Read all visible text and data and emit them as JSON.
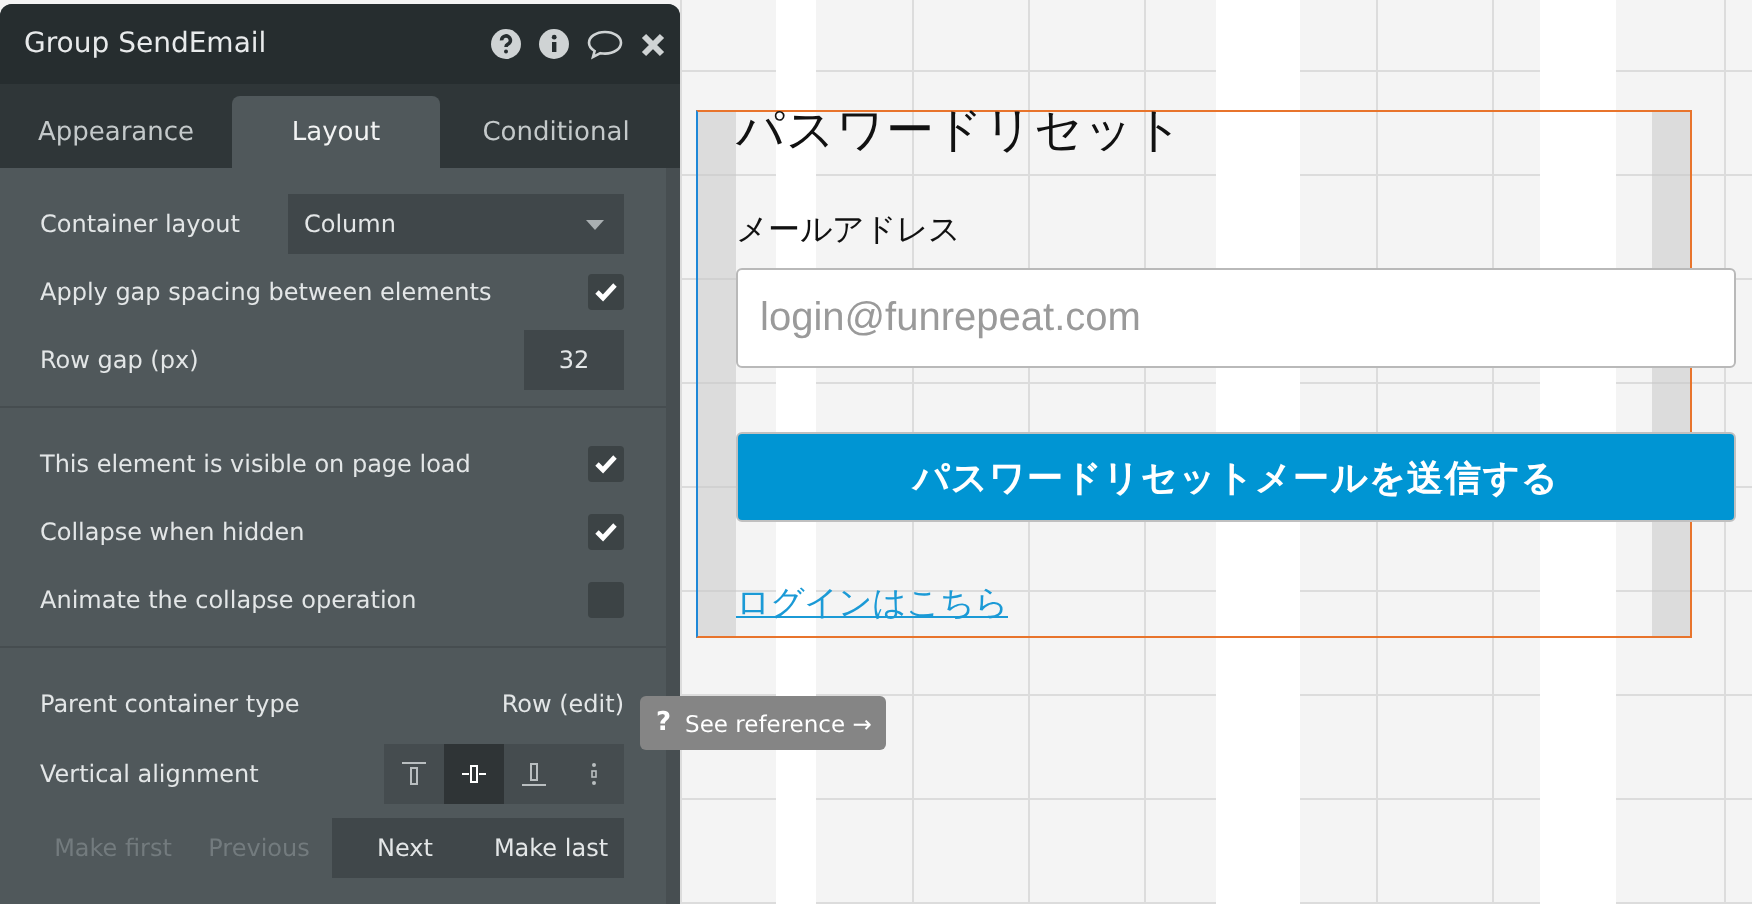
{
  "panel": {
    "title": "Group SendEmail",
    "tabs": [
      {
        "label": "Appearance",
        "selected": false
      },
      {
        "label": "Layout",
        "selected": true
      },
      {
        "label": "Conditional",
        "selected": false
      }
    ],
    "container_layout": {
      "label": "Container layout",
      "value": "Column"
    },
    "gap_spacing": {
      "label": "Apply gap spacing between elements",
      "checked": true
    },
    "row_gap": {
      "label": "Row gap (px)",
      "value": "32"
    },
    "visibility": [
      {
        "label": "This element is visible on page load",
        "checked": true
      },
      {
        "label": "Collapse when hidden",
        "checked": true
      },
      {
        "label": "Animate the collapse operation",
        "checked": false
      }
    ],
    "parent_container": {
      "label": "Parent container type",
      "value": "Row (edit)"
    },
    "vertical_alignment": {
      "label": "Vertical alignment",
      "options": [
        {
          "kind": "top",
          "selected": false
        },
        {
          "kind": "center",
          "selected": true
        },
        {
          "kind": "bottom",
          "selected": false
        },
        {
          "kind": "stretch",
          "selected": false
        }
      ]
    },
    "order_buttons": [
      {
        "label": "Make first",
        "disabled": true
      },
      {
        "label": "Previous",
        "disabled": true
      },
      {
        "label": "Next",
        "disabled": false
      },
      {
        "label": "Make last",
        "disabled": false
      }
    ]
  },
  "tooltip": {
    "icon": "?",
    "text": "See reference →"
  },
  "canvas": {
    "title": "パスワードリセット",
    "email_label": "メールアドレス",
    "email_placeholder": "login@funrepeat.com",
    "submit_button": "パスワードリセットメールを送信する",
    "login_link": "ログインはこちら"
  }
}
